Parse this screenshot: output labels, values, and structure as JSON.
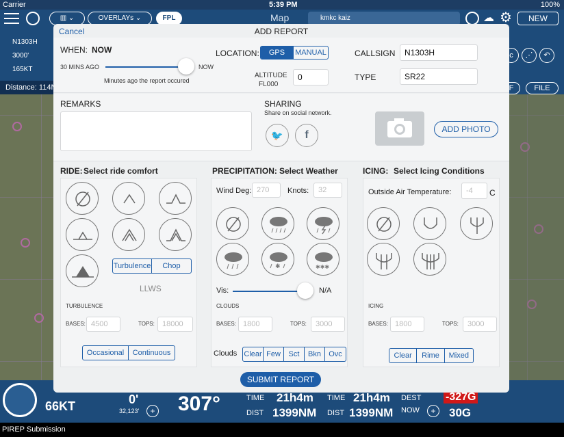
{
  "status": {
    "carrier": "Carrier",
    "time": "5:39 PM",
    "battery": "100%"
  },
  "topbar": {
    "overlays": "OVERLAYs",
    "fpl": "FPL",
    "title": "Map",
    "search": "kmkc kaiz",
    "new": "NEW"
  },
  "left_info": {
    "tail": "N1303H",
    "altitude": "3000'",
    "speed": "165KT",
    "distance": "Distance: 114N"
  },
  "right_info": {
    "btn1": "F",
    "btn2": "FILE"
  },
  "modal": {
    "cancel": "Cancel",
    "title": "ADD REPORT",
    "when": {
      "label": "WHEN:",
      "value": "NOW",
      "left": "30 MINS AGO",
      "right": "NOW",
      "hint": "Minutes ago the report occured",
      "slider_fraction": 1.0
    },
    "location": {
      "label": "LOCATION:",
      "options": [
        "GPS",
        "MANUAL"
      ],
      "selected": "GPS"
    },
    "altitude": {
      "label1": "ALTITUDE",
      "label2": "FL000",
      "value": "0"
    },
    "callsign": {
      "label": "CALLSIGN",
      "value": "N1303H"
    },
    "type": {
      "label": "TYPE",
      "value": "SR22"
    },
    "remarks": {
      "label": "REMARKS"
    },
    "sharing": {
      "label": "SHARING",
      "hint": "Share on social network.",
      "twitter": "🐦",
      "facebook": "f"
    },
    "add_photo": "ADD PHOTO",
    "ride": {
      "label": "RIDE:",
      "sub": "Select ride comfort",
      "seg": [
        "Turbulence",
        "Chop"
      ],
      "llws": "LLWS",
      "turb_label": "TURBULENCE",
      "bases_label": "BASES:",
      "bases_ph": "4500",
      "tops_label": "TOPS:",
      "tops_ph": "18000",
      "freq": [
        "Occasional",
        "Continuous"
      ]
    },
    "precip": {
      "label": "PRECIPITATION:",
      "sub": "Select Weather",
      "wind_label": "Wind Deg:",
      "wind_ph": "270",
      "knots_label": "Knots:",
      "knots_ph": "32",
      "vis_label": "Vis:",
      "vis_value": "N/A",
      "vis_fraction": 1.0,
      "clouds_label": "CLOUDS",
      "bases_label": "BASES:",
      "bases_ph": "1800",
      "tops_label": "TOPS:",
      "tops_ph": "3000",
      "clouds_row_label": "Clouds",
      "cloud_opts": [
        "Clear",
        "Few",
        "Sct",
        "Bkn",
        "Ovc"
      ]
    },
    "icing": {
      "label": "ICING:",
      "sub": "Select Icing Conditions",
      "oat_label": "Outside Air Temperature:",
      "oat_ph": "-4",
      "oat_unit": "C",
      "ice_label": "ICING",
      "bases_label": "BASES:",
      "bases_ph": "1800",
      "tops_label": "TOPS:",
      "tops_ph": "3000",
      "opts": [
        "Clear",
        "Rime",
        "Mixed"
      ]
    },
    "submit": "SUBMIT REPORT"
  },
  "bottom": {
    "speed": "66KT",
    "alt": "0'",
    "alt_sub": "32,123'",
    "heading": "307°",
    "time1_label": "TIME",
    "time1": "21h4m",
    "dist1_label": "DIST",
    "dist1": "1399NM",
    "time2_label": "TIME",
    "time2": "21h4m",
    "dist2_label": "DIST",
    "dist2": "1399NM",
    "dest_label": "DEST",
    "now_label": "NOW",
    "dest_val": "-327G",
    "now_val": "30G",
    "dest_color": "#d01818"
  },
  "caption": "PIREP Submission"
}
